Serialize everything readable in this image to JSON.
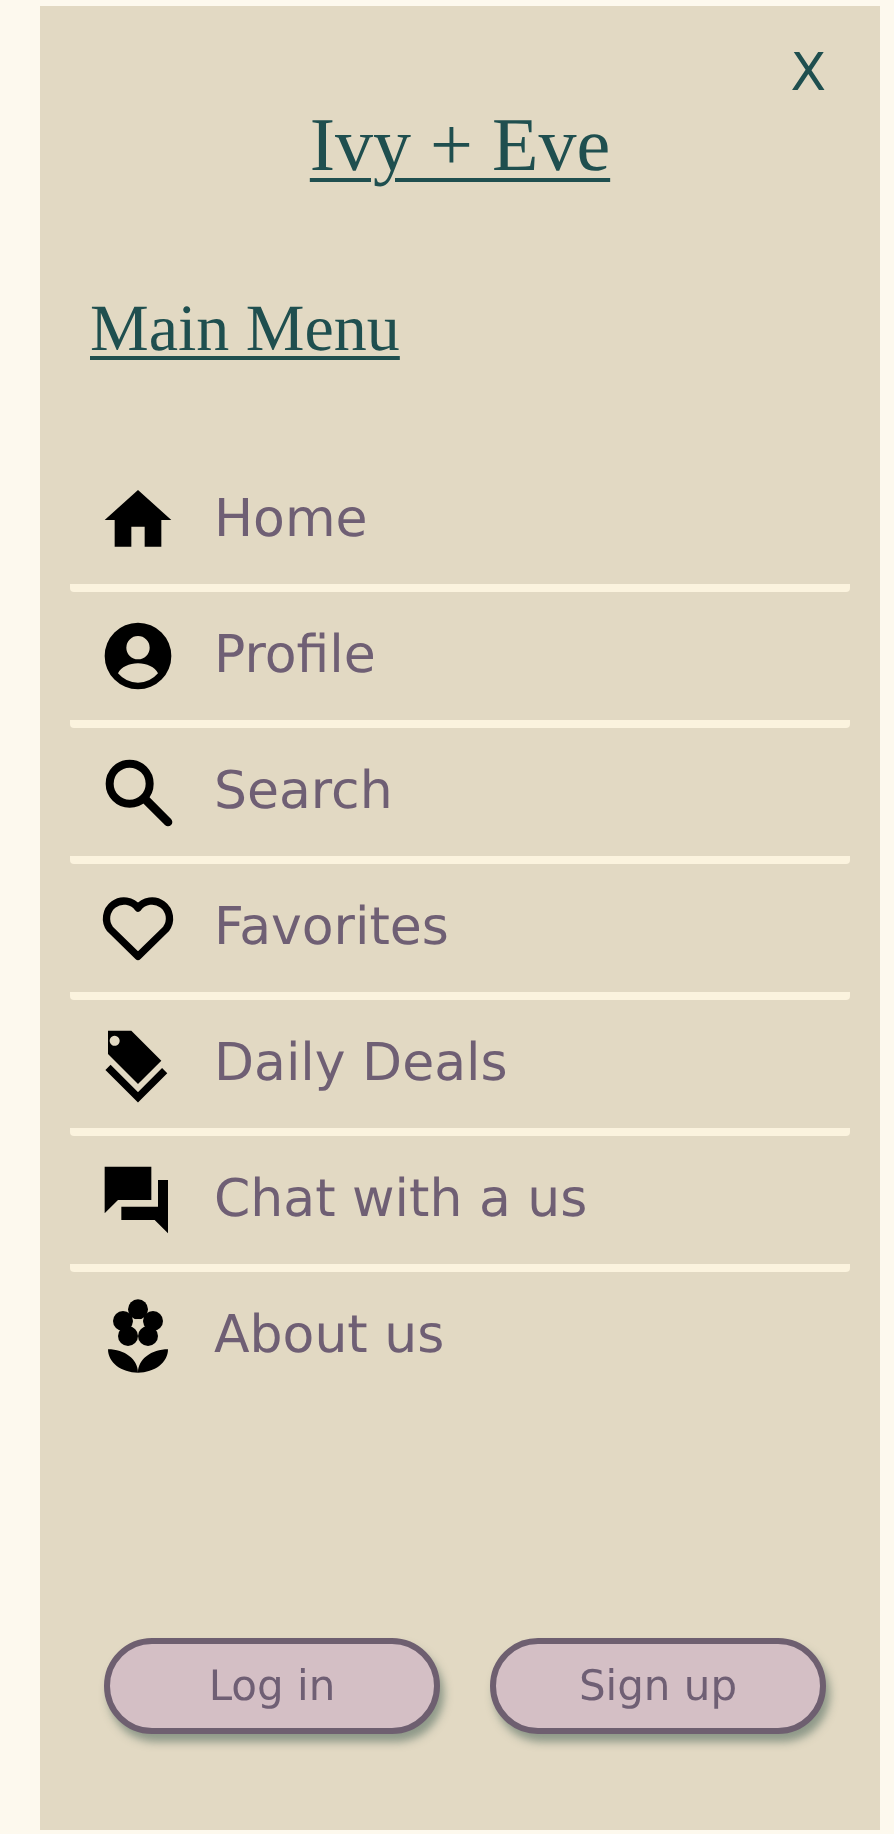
{
  "close": {
    "label": "X"
  },
  "brand": {
    "title": "Ivy + Eve"
  },
  "menu_heading": "Main Menu",
  "items": [
    {
      "label": "Home"
    },
    {
      "label": "Profile"
    },
    {
      "label": "Search"
    },
    {
      "label": "Favorites"
    },
    {
      "label": "Daily Deals"
    },
    {
      "label": "Chat with a us"
    },
    {
      "label": "About us"
    }
  ],
  "buttons": [
    {
      "label": "Log in"
    },
    {
      "label": "Sign up"
    }
  ]
}
